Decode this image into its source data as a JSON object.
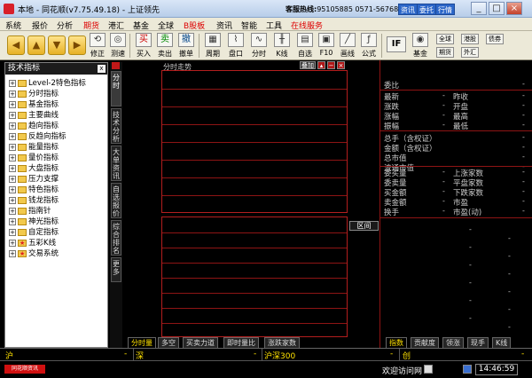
{
  "window": {
    "title": "本地 - 同花顺(v7.75.49.18) - 上证领先",
    "hotline_label": "客服热线:",
    "hotline_numbers": "95105885 0571-56768888",
    "top_buttons": [
      "资讯",
      "委托",
      "行情"
    ],
    "controls": [
      "_",
      "□",
      "×"
    ]
  },
  "menu": [
    "系统",
    "报价",
    "分析",
    "期货",
    "港汇",
    "基金",
    "全球",
    "B股板",
    "资讯",
    "智能",
    "工具",
    "在线服务"
  ],
  "toolbar": {
    "tools": [
      {
        "label": "修正",
        "icon": "correct-icon"
      },
      {
        "label": "测速",
        "icon": "speed-icon"
      },
      {
        "label": "买入",
        "icon": "buy-icon",
        "glyph": "买"
      },
      {
        "label": "卖出",
        "icon": "sell-icon",
        "glyph": "卖"
      },
      {
        "label": "撤单",
        "icon": "cancel-order-icon",
        "glyph": "撤"
      },
      {
        "label": "周期",
        "icon": "period-icon"
      },
      {
        "label": "盘口",
        "icon": "orderbook-icon"
      },
      {
        "label": "分时",
        "icon": "timeshare-icon"
      },
      {
        "label": "K线",
        "icon": "kline-icon"
      },
      {
        "label": "自选",
        "icon": "watchlist-icon"
      },
      {
        "label": "F10",
        "icon": "f10-icon"
      },
      {
        "label": "画线",
        "icon": "draw-line-icon"
      },
      {
        "label": "公式",
        "icon": "formula-icon"
      },
      {
        "label": "基金",
        "icon": "fund-icon"
      }
    ],
    "small_buttons": [
      "全球",
      "港股",
      "债券",
      "期货",
      "外汇"
    ],
    "if_label": "IF"
  },
  "left_panel": {
    "title": "技术指标",
    "close": "x",
    "items": [
      {
        "label": "Level-2特色指标",
        "toggle": "+"
      },
      {
        "label": "分时指标",
        "toggle": "+"
      },
      {
        "label": "基金指标",
        "toggle": "+"
      },
      {
        "label": "主要曲线",
        "toggle": "+"
      },
      {
        "label": "趋向指标",
        "toggle": "+"
      },
      {
        "label": "反趋向指标",
        "toggle": "+"
      },
      {
        "label": "能量指标",
        "toggle": "+"
      },
      {
        "label": "量价指标",
        "toggle": "+"
      },
      {
        "label": "大盘指标",
        "toggle": "+"
      },
      {
        "label": "压力支撑",
        "toggle": "+"
      },
      {
        "label": "特色指标",
        "toggle": "+"
      },
      {
        "label": "钱龙指标",
        "toggle": "+"
      },
      {
        "label": "指南针",
        "toggle": "+"
      },
      {
        "label": "神光指标",
        "toggle": "+"
      },
      {
        "label": "自定指标",
        "toggle": "+"
      },
      {
        "label": "五彩K线",
        "toggle": "+",
        "star": true
      },
      {
        "label": "交易系统",
        "toggle": "+",
        "star": true
      }
    ]
  },
  "vtabs": [
    "分时",
    "技术分析",
    "大单资讯",
    "自选报价",
    "综合排名",
    "更多"
  ],
  "chart": {
    "title": "分时走势",
    "ctl_label": "叠加",
    "range_label": "区间"
  },
  "bottom_tabs": [
    "分时量",
    "多空",
    "买卖力道",
    "即时量比",
    "涨跌家数"
  ],
  "right_panel": {
    "rows_a": [
      "委比",
      "最新",
      "涨跌",
      "涨幅",
      "振幅"
    ],
    "rows_a_right": [
      "昨收",
      "开盘",
      "最高",
      "最低"
    ],
    "rows_b": [
      "总手（含权证）",
      "金额（含权证）",
      "总市值",
      "流通市值"
    ],
    "rows_c": [
      "委买量",
      "委卖量",
      "买金额",
      "卖金额",
      "换手"
    ],
    "rows_c_right": [
      "上涨家数",
      "平盘家数",
      "下跌家数",
      "市盈",
      "市盈(动)"
    ],
    "tabs": [
      "指数",
      "贡献度",
      "领涨",
      "现手",
      "K线"
    ]
  },
  "statusbar": {
    "items": [
      "沪",
      "深",
      "沪深300",
      "创"
    ]
  },
  "bottombar": {
    "brand": "同花顺资讯",
    "welcome": "欢迎访问网",
    "time": "14:46:59"
  }
}
